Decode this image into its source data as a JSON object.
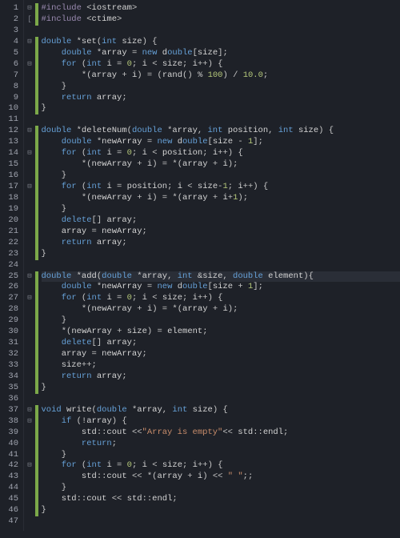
{
  "lineCount": 47,
  "foldMarks": {
    "1": "⊟",
    "2": "[",
    "4": "⊟",
    "6": "⊟",
    "12": "⊟",
    "14": "⊟",
    "17": "⊟",
    "25": "⊟",
    "27": "⊟",
    "37": "⊟",
    "38": "⊟",
    "42": "⊟"
  },
  "highlightLine": 25,
  "modifiedRanges": [
    [
      1,
      2
    ],
    [
      4,
      10
    ],
    [
      12,
      23
    ],
    [
      25,
      35
    ],
    [
      37,
      46
    ]
  ],
  "tokens": {
    "1": [
      [
        "pre",
        "#include"
      ],
      [
        "punc",
        " <"
      ],
      [
        "id",
        "iostream"
      ],
      [
        "punc",
        ">"
      ]
    ],
    "2": [
      [
        "pre",
        "#include"
      ],
      [
        "punc",
        " <"
      ],
      [
        "id",
        "ctime"
      ],
      [
        "punc",
        ">"
      ]
    ],
    "3": [],
    "4": [
      [
        "type",
        "double"
      ],
      [
        "op",
        " *"
      ],
      [
        "fn",
        "set"
      ],
      [
        "punc",
        "("
      ],
      [
        "type",
        "int"
      ],
      [
        "id",
        " size"
      ],
      [
        "punc",
        ") {"
      ]
    ],
    "5": [
      [
        "id",
        "    "
      ],
      [
        "type",
        "double"
      ],
      [
        "op",
        " *"
      ],
      [
        "id",
        "array "
      ],
      [
        "op",
        "="
      ],
      [
        "id",
        " "
      ],
      [
        "kw",
        "new"
      ],
      [
        "id",
        " d"
      ],
      [
        "type",
        "ouble"
      ],
      [
        "punc",
        "["
      ],
      [
        "id",
        "size"
      ],
      [
        "punc",
        "];"
      ]
    ],
    "6": [
      [
        "id",
        "    "
      ],
      [
        "kw",
        "for"
      ],
      [
        "punc",
        " ("
      ],
      [
        "type",
        "int"
      ],
      [
        "id",
        " i "
      ],
      [
        "op",
        "="
      ],
      [
        "id",
        " "
      ],
      [
        "num",
        "0"
      ],
      [
        "punc",
        "; "
      ],
      [
        "id",
        "i "
      ],
      [
        "op",
        "<"
      ],
      [
        "id",
        " size"
      ],
      [
        "punc",
        "; "
      ],
      [
        "id",
        "i"
      ],
      [
        "op",
        "++"
      ],
      [
        "punc",
        ") {"
      ]
    ],
    "7": [
      [
        "id",
        "        "
      ],
      [
        "op",
        "*"
      ],
      [
        "punc",
        "("
      ],
      [
        "id",
        "array "
      ],
      [
        "op",
        "+"
      ],
      [
        "id",
        " i"
      ],
      [
        "punc",
        ") "
      ],
      [
        "op",
        "="
      ],
      [
        "punc",
        " ("
      ],
      [
        "fn",
        "rand"
      ],
      [
        "punc",
        "() "
      ],
      [
        "op",
        "%"
      ],
      [
        "id",
        " "
      ],
      [
        "num",
        "100"
      ],
      [
        "punc",
        ") "
      ],
      [
        "op",
        "/"
      ],
      [
        "id",
        " "
      ],
      [
        "num",
        "10.0"
      ],
      [
        "punc",
        ";"
      ]
    ],
    "8": [
      [
        "punc",
        "    }"
      ]
    ],
    "9": [
      [
        "id",
        "    "
      ],
      [
        "kw",
        "return"
      ],
      [
        "id",
        " array"
      ],
      [
        "punc",
        ";"
      ]
    ],
    "10": [
      [
        "punc",
        "}"
      ]
    ],
    "11": [],
    "12": [
      [
        "type",
        "double"
      ],
      [
        "op",
        " *"
      ],
      [
        "fn",
        "deleteNum"
      ],
      [
        "punc",
        "("
      ],
      [
        "type",
        "double"
      ],
      [
        "op",
        " *"
      ],
      [
        "id",
        "array"
      ],
      [
        "punc",
        ", "
      ],
      [
        "type",
        "int"
      ],
      [
        "id",
        " position"
      ],
      [
        "punc",
        ", "
      ],
      [
        "type",
        "int"
      ],
      [
        "id",
        " size"
      ],
      [
        "punc",
        ") {"
      ]
    ],
    "13": [
      [
        "id",
        "    "
      ],
      [
        "type",
        "double"
      ],
      [
        "op",
        " *"
      ],
      [
        "id",
        "newArray "
      ],
      [
        "op",
        "="
      ],
      [
        "id",
        " "
      ],
      [
        "kw",
        "new"
      ],
      [
        "id",
        " d"
      ],
      [
        "type",
        "ouble"
      ],
      [
        "punc",
        "["
      ],
      [
        "id",
        "size "
      ],
      [
        "op",
        "-"
      ],
      [
        "id",
        " "
      ],
      [
        "num",
        "1"
      ],
      [
        "punc",
        "];"
      ]
    ],
    "14": [
      [
        "id",
        "    "
      ],
      [
        "kw",
        "for"
      ],
      [
        "punc",
        " ("
      ],
      [
        "type",
        "int"
      ],
      [
        "id",
        " i "
      ],
      [
        "op",
        "="
      ],
      [
        "id",
        " "
      ],
      [
        "num",
        "0"
      ],
      [
        "punc",
        "; "
      ],
      [
        "id",
        "i "
      ],
      [
        "op",
        "<"
      ],
      [
        "id",
        " position"
      ],
      [
        "punc",
        "; "
      ],
      [
        "id",
        "i"
      ],
      [
        "op",
        "++"
      ],
      [
        "punc",
        ") {"
      ]
    ],
    "15": [
      [
        "id",
        "        "
      ],
      [
        "op",
        "*"
      ],
      [
        "punc",
        "("
      ],
      [
        "id",
        "newArray "
      ],
      [
        "op",
        "+"
      ],
      [
        "id",
        " i"
      ],
      [
        "punc",
        ") "
      ],
      [
        "op",
        "="
      ],
      [
        "id",
        " "
      ],
      [
        "op",
        "*"
      ],
      [
        "punc",
        "("
      ],
      [
        "id",
        "array "
      ],
      [
        "op",
        "+"
      ],
      [
        "id",
        " i"
      ],
      [
        "punc",
        ");"
      ]
    ],
    "16": [
      [
        "punc",
        "    }"
      ]
    ],
    "17": [
      [
        "id",
        "    "
      ],
      [
        "kw",
        "for"
      ],
      [
        "punc",
        " ("
      ],
      [
        "type",
        "int"
      ],
      [
        "id",
        " i "
      ],
      [
        "op",
        "="
      ],
      [
        "id",
        " position"
      ],
      [
        "punc",
        "; "
      ],
      [
        "id",
        "i "
      ],
      [
        "op",
        "<"
      ],
      [
        "id",
        " size"
      ],
      [
        "op",
        "-"
      ],
      [
        "num",
        "1"
      ],
      [
        "punc",
        "; "
      ],
      [
        "id",
        "i"
      ],
      [
        "op",
        "++"
      ],
      [
        "punc",
        ") {"
      ]
    ],
    "18": [
      [
        "id",
        "        "
      ],
      [
        "op",
        "*"
      ],
      [
        "punc",
        "("
      ],
      [
        "id",
        "newArray "
      ],
      [
        "op",
        "+"
      ],
      [
        "id",
        " i"
      ],
      [
        "punc",
        ") "
      ],
      [
        "op",
        "="
      ],
      [
        "id",
        " "
      ],
      [
        "op",
        "*"
      ],
      [
        "punc",
        "("
      ],
      [
        "id",
        "array "
      ],
      [
        "op",
        "+"
      ],
      [
        "id",
        " i"
      ],
      [
        "op",
        "+"
      ],
      [
        "num",
        "1"
      ],
      [
        "punc",
        ");"
      ]
    ],
    "19": [
      [
        "punc",
        "    }"
      ]
    ],
    "20": [
      [
        "id",
        "    "
      ],
      [
        "kw",
        "delete"
      ],
      [
        "punc",
        "[] "
      ],
      [
        "id",
        "array"
      ],
      [
        "punc",
        ";"
      ]
    ],
    "21": [
      [
        "id",
        "    array "
      ],
      [
        "op",
        "="
      ],
      [
        "id",
        " newArray"
      ],
      [
        "punc",
        ";"
      ]
    ],
    "22": [
      [
        "id",
        "    "
      ],
      [
        "kw",
        "return"
      ],
      [
        "id",
        " array"
      ],
      [
        "punc",
        ";"
      ]
    ],
    "23": [
      [
        "punc",
        "}"
      ]
    ],
    "24": [],
    "25": [
      [
        "type",
        "double"
      ],
      [
        "op",
        " *"
      ],
      [
        "fn",
        "add"
      ],
      [
        "punc",
        "("
      ],
      [
        "type",
        "double"
      ],
      [
        "op",
        " *"
      ],
      [
        "id",
        "array"
      ],
      [
        "punc",
        ", "
      ],
      [
        "type",
        "int"
      ],
      [
        "op",
        " &"
      ],
      [
        "id",
        "size"
      ],
      [
        "punc",
        ", "
      ],
      [
        "type",
        "double"
      ],
      [
        "id",
        " element"
      ],
      [
        "punc",
        "){"
      ]
    ],
    "26": [
      [
        "id",
        "    "
      ],
      [
        "type",
        "double"
      ],
      [
        "op",
        " *"
      ],
      [
        "id",
        "newArray "
      ],
      [
        "op",
        "="
      ],
      [
        "id",
        " "
      ],
      [
        "kw",
        "new"
      ],
      [
        "id",
        " d"
      ],
      [
        "type",
        "ouble"
      ],
      [
        "punc",
        "["
      ],
      [
        "id",
        "size "
      ],
      [
        "op",
        "+"
      ],
      [
        "id",
        " "
      ],
      [
        "num",
        "1"
      ],
      [
        "punc",
        "];"
      ]
    ],
    "27": [
      [
        "id",
        "    "
      ],
      [
        "kw",
        "for"
      ],
      [
        "punc",
        " ("
      ],
      [
        "type",
        "int"
      ],
      [
        "id",
        " i "
      ],
      [
        "op",
        "="
      ],
      [
        "id",
        " "
      ],
      [
        "num",
        "0"
      ],
      [
        "punc",
        "; "
      ],
      [
        "id",
        "i "
      ],
      [
        "op",
        "<"
      ],
      [
        "id",
        " size"
      ],
      [
        "punc",
        "; "
      ],
      [
        "id",
        "i"
      ],
      [
        "op",
        "++"
      ],
      [
        "punc",
        ") {"
      ]
    ],
    "28": [
      [
        "id",
        "        "
      ],
      [
        "op",
        "*"
      ],
      [
        "punc",
        "("
      ],
      [
        "id",
        "newArray "
      ],
      [
        "op",
        "+"
      ],
      [
        "id",
        " i"
      ],
      [
        "punc",
        ") "
      ],
      [
        "op",
        "="
      ],
      [
        "id",
        " "
      ],
      [
        "op",
        "*"
      ],
      [
        "punc",
        "("
      ],
      [
        "id",
        "array "
      ],
      [
        "op",
        "+"
      ],
      [
        "id",
        " i"
      ],
      [
        "punc",
        ");"
      ]
    ],
    "29": [
      [
        "punc",
        "    }"
      ]
    ],
    "30": [
      [
        "id",
        "    "
      ],
      [
        "op",
        "*"
      ],
      [
        "punc",
        "("
      ],
      [
        "id",
        "newArray "
      ],
      [
        "op",
        "+"
      ],
      [
        "id",
        " size"
      ],
      [
        "punc",
        ") "
      ],
      [
        "op",
        "="
      ],
      [
        "id",
        " element"
      ],
      [
        "punc",
        ";"
      ]
    ],
    "31": [
      [
        "id",
        "    "
      ],
      [
        "kw",
        "delete"
      ],
      [
        "punc",
        "[] "
      ],
      [
        "id",
        "array"
      ],
      [
        "punc",
        ";"
      ]
    ],
    "32": [
      [
        "id",
        "    array "
      ],
      [
        "op",
        "="
      ],
      [
        "id",
        " newArray"
      ],
      [
        "punc",
        ";"
      ]
    ],
    "33": [
      [
        "id",
        "    size"
      ],
      [
        "op",
        "++"
      ],
      [
        "punc",
        ";"
      ]
    ],
    "34": [
      [
        "id",
        "    "
      ],
      [
        "kw",
        "return"
      ],
      [
        "id",
        " array"
      ],
      [
        "punc",
        ";"
      ]
    ],
    "35": [
      [
        "punc",
        "}"
      ]
    ],
    "36": [],
    "37": [
      [
        "type",
        "void"
      ],
      [
        "id",
        " "
      ],
      [
        "fn",
        "write"
      ],
      [
        "punc",
        "("
      ],
      [
        "type",
        "double"
      ],
      [
        "op",
        " *"
      ],
      [
        "id",
        "array"
      ],
      [
        "punc",
        ", "
      ],
      [
        "type",
        "int"
      ],
      [
        "id",
        " size"
      ],
      [
        "punc",
        ") {"
      ]
    ],
    "38": [
      [
        "id",
        "    "
      ],
      [
        "kw",
        "if"
      ],
      [
        "punc",
        " ("
      ],
      [
        "op",
        "!"
      ],
      [
        "id",
        "array"
      ],
      [
        "punc",
        ") {"
      ]
    ],
    "39": [
      [
        "id",
        "        std"
      ],
      [
        "op",
        "::"
      ],
      [
        "id",
        "cout "
      ],
      [
        "op",
        "<<"
      ],
      [
        "str",
        "\"Array is empty\""
      ],
      [
        "op",
        "<<"
      ],
      [
        "id",
        " std"
      ],
      [
        "op",
        "::"
      ],
      [
        "id",
        "endl"
      ],
      [
        "punc",
        ";"
      ]
    ],
    "40": [
      [
        "id",
        "        "
      ],
      [
        "kw",
        "return"
      ],
      [
        "punc",
        ";"
      ]
    ],
    "41": [
      [
        "punc",
        "    }"
      ]
    ],
    "42": [
      [
        "id",
        "    "
      ],
      [
        "kw",
        "for"
      ],
      [
        "punc",
        " ("
      ],
      [
        "type",
        "int"
      ],
      [
        "id",
        " i "
      ],
      [
        "op",
        "="
      ],
      [
        "id",
        " "
      ],
      [
        "num",
        "0"
      ],
      [
        "punc",
        "; "
      ],
      [
        "id",
        "i "
      ],
      [
        "op",
        "<"
      ],
      [
        "id",
        " size"
      ],
      [
        "punc",
        "; "
      ],
      [
        "id",
        "i"
      ],
      [
        "op",
        "++"
      ],
      [
        "punc",
        ") {"
      ]
    ],
    "43": [
      [
        "id",
        "        std"
      ],
      [
        "op",
        "::"
      ],
      [
        "id",
        "cout "
      ],
      [
        "op",
        "<<"
      ],
      [
        "id",
        " "
      ],
      [
        "op",
        "*"
      ],
      [
        "punc",
        "("
      ],
      [
        "id",
        "array "
      ],
      [
        "op",
        "+"
      ],
      [
        "id",
        " i"
      ],
      [
        "punc",
        ") "
      ],
      [
        "op",
        "<<"
      ],
      [
        "id",
        " "
      ],
      [
        "str",
        "\" \""
      ],
      [
        "punc",
        ";;"
      ]
    ],
    "44": [
      [
        "punc",
        "    }"
      ]
    ],
    "45": [
      [
        "id",
        "    std"
      ],
      [
        "op",
        "::"
      ],
      [
        "id",
        "cout "
      ],
      [
        "op",
        "<<"
      ],
      [
        "id",
        " std"
      ],
      [
        "op",
        "::"
      ],
      [
        "id",
        "endl"
      ],
      [
        "punc",
        ";"
      ]
    ],
    "46": [
      [
        "punc",
        "}"
      ]
    ],
    "47": []
  }
}
